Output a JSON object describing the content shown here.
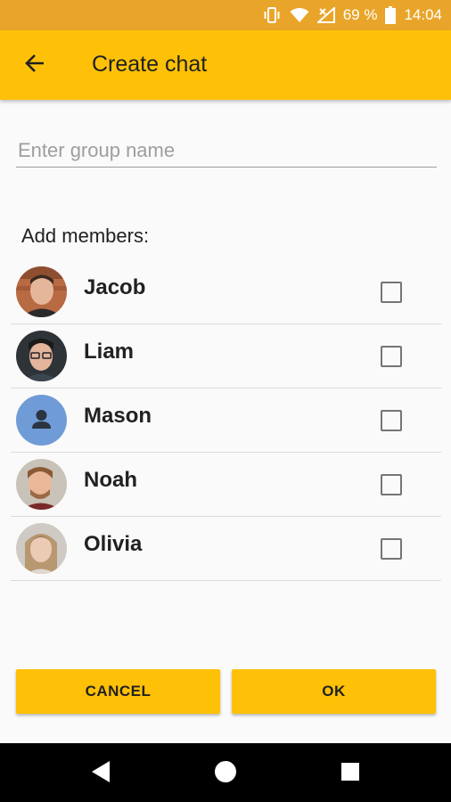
{
  "status_bar": {
    "battery_percent": "69 %",
    "time": "14:04",
    "icons": [
      "vibrate-icon",
      "wifi-icon",
      "signal-icon",
      "battery-icon"
    ]
  },
  "app_bar": {
    "title": "Create chat",
    "back_icon": "arrow-back-icon"
  },
  "form": {
    "group_name_placeholder": "Enter group name",
    "group_name_value": ""
  },
  "members_label": "Add members:",
  "members": [
    {
      "name": "Jacob",
      "checked": false
    },
    {
      "name": "Liam",
      "checked": false
    },
    {
      "name": "Mason",
      "checked": false
    },
    {
      "name": "Noah",
      "checked": false
    },
    {
      "name": "Olivia",
      "checked": false
    }
  ],
  "buttons": {
    "cancel_label": "CANCEL",
    "ok_label": "OK"
  },
  "colors": {
    "status_bar": "#e9a52a",
    "app_bar": "#ffc107",
    "accent": "#ffc107",
    "placeholder_avatar": "#6f9bd6"
  },
  "nav_bar": {
    "icons": [
      "back-triangle-icon",
      "home-circle-icon",
      "recents-square-icon"
    ]
  }
}
